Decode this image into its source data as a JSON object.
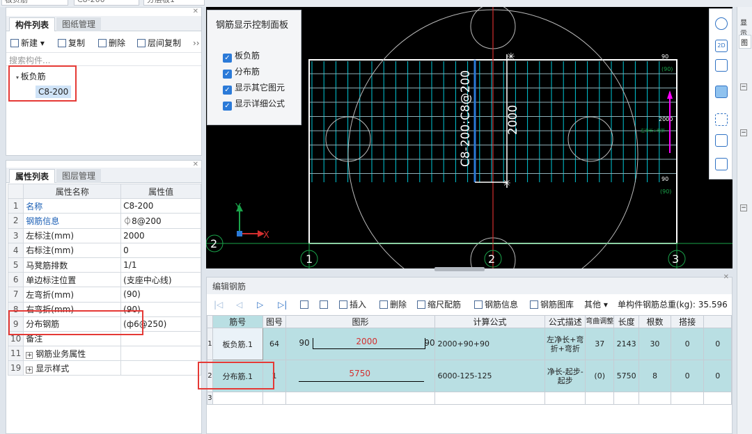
{
  "topbar": {
    "box1": "板负筋",
    "box2": "C8-200",
    "box3": "分层板1"
  },
  "component_panel": {
    "tab_active": "构件列表",
    "tab_inactive": "图纸管理",
    "toolbar": {
      "new": "新建",
      "copy": "复制",
      "delete": "删除",
      "floor_copy": "层间复制",
      "more": "››"
    },
    "search_placeholder": "搜索构件...",
    "tree_root": "板负筋",
    "tree_child": "C8-200"
  },
  "prop_panel": {
    "tab_active": "属性列表",
    "tab_inactive": "图层管理",
    "header_name": "属性名称",
    "header_value": "属性值",
    "rows": [
      {
        "idx": "1",
        "name": "名称",
        "value": "C8-200"
      },
      {
        "idx": "2",
        "name": "钢筋信息",
        "value": "⏀8@200"
      },
      {
        "idx": "3",
        "name": "左标注(mm)",
        "value": "2000"
      },
      {
        "idx": "4",
        "name": "右标注(mm)",
        "value": "0"
      },
      {
        "idx": "5",
        "name": "马凳筋排数",
        "value": "1/1"
      },
      {
        "idx": "6",
        "name": "单边标注位置",
        "value": "(支座中心线)"
      },
      {
        "idx": "7",
        "name": "左弯折(mm)",
        "value": "(90)"
      },
      {
        "idx": "8",
        "name": "右弯折(mm)",
        "value": "(90)"
      },
      {
        "idx": "9",
        "name": "分布钢筋",
        "value": "(ф6@250)"
      },
      {
        "idx": "10",
        "name": "备注",
        "value": ""
      },
      {
        "idx": "11",
        "name": "钢筋业务属性",
        "value": ""
      },
      {
        "idx": "19",
        "name": "显示样式",
        "value": ""
      }
    ]
  },
  "control_panel": {
    "title": "钢筋显示控制面板",
    "items": [
      "板负筋",
      "分布筋",
      "显示其它图元",
      "显示详细公式"
    ]
  },
  "cad": {
    "rebar_label": "C8-200:C8@200",
    "dim_2000": "2000",
    "dim_90_top": "90",
    "dim_90_paren_top": "(90)",
    "dim_2000_right": "2000",
    "dim_90_bottom": "90",
    "dim_90_paren_bottom": "(90)",
    "axis_1": "1",
    "axis_2": "2",
    "axis_3": "3",
    "axis_2_left": "2",
    "axis_x": "X",
    "axis_y": "Y",
    "annotation_small": "左净长+弯折",
    "colors": {
      "rebar": "#00c8d7",
      "grid": "#1aa34a",
      "line": "#ffffff",
      "red": "#d32f2f",
      "magenta": "#ff00ff"
    }
  },
  "right_tools": [
    "sphere-icon",
    "2d-icon",
    "cube-icon",
    "cube-blue-icon",
    "fit-icon",
    "view-icon",
    "formula-icon"
  ],
  "edit_panel": {
    "title": "编辑钢筋",
    "toolbar": {
      "insert": "插入",
      "delete": "删除",
      "scale": "缩尺配筋",
      "rebar_info": "钢筋信息",
      "rebar_lib": "钢筋图库",
      "other": "其他",
      "total": "单构件钢筋总重(kg): 35.596"
    },
    "headers": [
      "筋号",
      "图号",
      "图形",
      "计算公式",
      "公式描述",
      "弯曲调整",
      "长度",
      "根数",
      "搭接"
    ],
    "rows": [
      {
        "idx": "1",
        "name": "板负筋.1",
        "fig": "64",
        "shape_left": "90",
        "shape_mid": "2000",
        "shape_right": "90",
        "formula": "2000+90+90",
        "desc": "左净长+弯折+弯折",
        "bend": "37",
        "length": "2143",
        "count": "30",
        "lap": "0",
        "extra": "0"
      },
      {
        "idx": "2",
        "name": "分布筋.1",
        "fig": "1",
        "shape_left": "",
        "shape_mid": "5750",
        "shape_right": "",
        "formula": "6000-125-125",
        "desc": "净长-起步-起步",
        "bend": "(0)",
        "length": "5750",
        "count": "8",
        "lap": "0",
        "extra": "0"
      },
      {
        "idx": "3",
        "name": "",
        "fig": "",
        "shape_left": "",
        "shape_mid": "",
        "shape_right": "",
        "formula": "",
        "desc": "",
        "bend": "",
        "length": "",
        "count": "",
        "lap": "",
        "extra": ""
      }
    ]
  },
  "far_right": {
    "label1": "显示",
    "label2": "图"
  }
}
